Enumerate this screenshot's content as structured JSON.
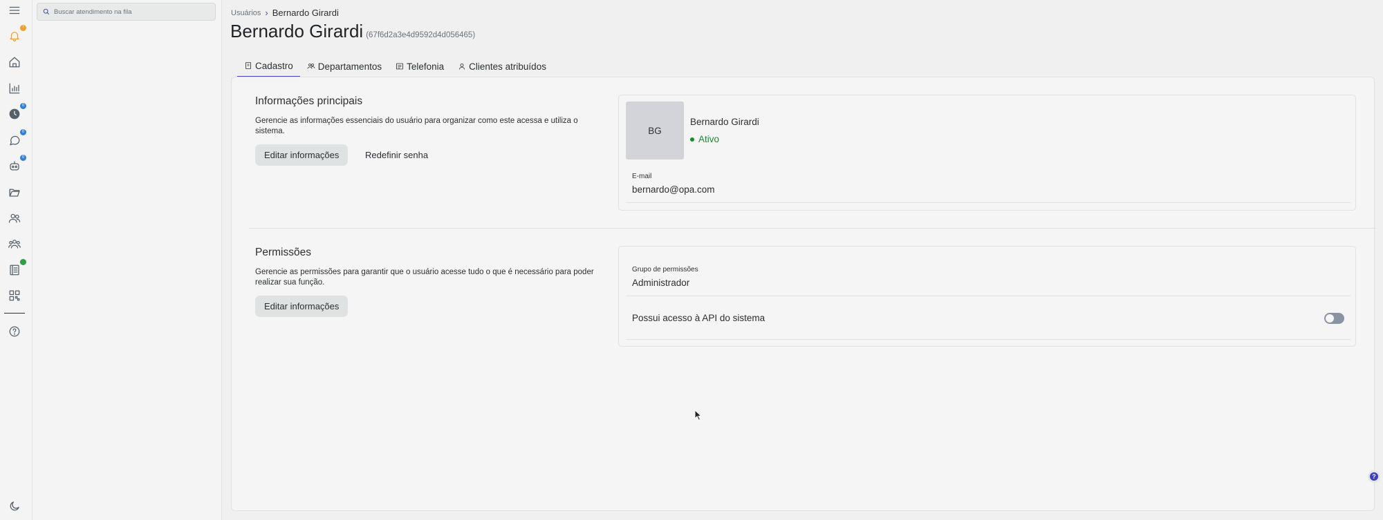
{
  "rail": {
    "badges": {
      "notifications": "!",
      "history": "0",
      "chat": "0",
      "bot": "0"
    },
    "colors": {
      "notification_badge": "#f0a030",
      "count_badge": "#2f7fdc",
      "status_badge": "#2ea043",
      "notification_icon": "#f0a030"
    }
  },
  "queue": {
    "search_placeholder": "Buscar atendimento na fila"
  },
  "breadcrumb": {
    "parent": "Usuários",
    "current": "Bernardo Girardi"
  },
  "header": {
    "title": "Bernardo Girardi",
    "id": "(67f6d2a3e4d9592d4d056465)"
  },
  "tabs": [
    {
      "label": "Cadastro",
      "icon": "document-icon",
      "active": true
    },
    {
      "label": "Departamentos",
      "icon": "users-group-icon",
      "active": false
    },
    {
      "label": "Telefonia",
      "icon": "phone-book-icon",
      "active": false
    },
    {
      "label": "Clientes atribuídos",
      "icon": "user-badge-icon",
      "active": false
    }
  ],
  "info_section": {
    "title": "Informações principais",
    "description": "Gerencie as informações essenciais do usuário para organizar como este acessa e utiliza o sistema.",
    "edit_label": "Editar informações",
    "reset_label": "Redefinir senha"
  },
  "profile": {
    "initials": "BG",
    "name": "Bernardo Girardi",
    "status": "Ativo",
    "email_label": "E-mail",
    "email": "bernardo@opa.com"
  },
  "permissions_section": {
    "title": "Permissões",
    "description": "Gerencie as permissões para garantir que o usuário acesse tudo o que é necessário para poder realizar sua função.",
    "edit_label": "Editar informações"
  },
  "permissions": {
    "group_label": "Grupo de permissões",
    "group_value": "Administrador",
    "api_access_label": "Possui acesso à API do sistema",
    "api_access_enabled": false
  },
  "help": {
    "label": "?"
  },
  "colors": {
    "accent": "#3b4bb3",
    "status_active": "#1a8a2e"
  }
}
